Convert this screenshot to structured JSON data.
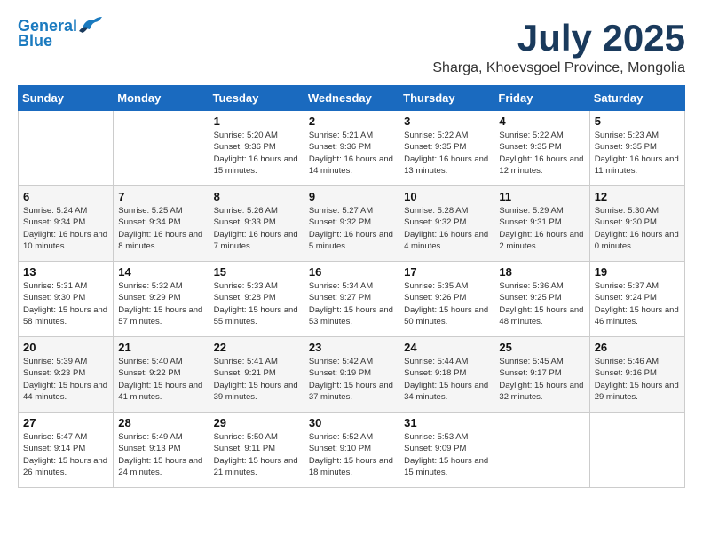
{
  "header": {
    "logo_line1": "General",
    "logo_line2": "Blue",
    "month_title": "July 2025",
    "location": "Sharga, Khoevsgoel Province, Mongolia"
  },
  "days_of_week": [
    "Sunday",
    "Monday",
    "Tuesday",
    "Wednesday",
    "Thursday",
    "Friday",
    "Saturday"
  ],
  "weeks": [
    [
      {
        "day": "",
        "sunrise": "",
        "sunset": "",
        "daylight": ""
      },
      {
        "day": "",
        "sunrise": "",
        "sunset": "",
        "daylight": ""
      },
      {
        "day": "1",
        "sunrise": "Sunrise: 5:20 AM",
        "sunset": "Sunset: 9:36 PM",
        "daylight": "Daylight: 16 hours and 15 minutes."
      },
      {
        "day": "2",
        "sunrise": "Sunrise: 5:21 AM",
        "sunset": "Sunset: 9:36 PM",
        "daylight": "Daylight: 16 hours and 14 minutes."
      },
      {
        "day": "3",
        "sunrise": "Sunrise: 5:22 AM",
        "sunset": "Sunset: 9:35 PM",
        "daylight": "Daylight: 16 hours and 13 minutes."
      },
      {
        "day": "4",
        "sunrise": "Sunrise: 5:22 AM",
        "sunset": "Sunset: 9:35 PM",
        "daylight": "Daylight: 16 hours and 12 minutes."
      },
      {
        "day": "5",
        "sunrise": "Sunrise: 5:23 AM",
        "sunset": "Sunset: 9:35 PM",
        "daylight": "Daylight: 16 hours and 11 minutes."
      }
    ],
    [
      {
        "day": "6",
        "sunrise": "Sunrise: 5:24 AM",
        "sunset": "Sunset: 9:34 PM",
        "daylight": "Daylight: 16 hours and 10 minutes."
      },
      {
        "day": "7",
        "sunrise": "Sunrise: 5:25 AM",
        "sunset": "Sunset: 9:34 PM",
        "daylight": "Daylight: 16 hours and 8 minutes."
      },
      {
        "day": "8",
        "sunrise": "Sunrise: 5:26 AM",
        "sunset": "Sunset: 9:33 PM",
        "daylight": "Daylight: 16 hours and 7 minutes."
      },
      {
        "day": "9",
        "sunrise": "Sunrise: 5:27 AM",
        "sunset": "Sunset: 9:32 PM",
        "daylight": "Daylight: 16 hours and 5 minutes."
      },
      {
        "day": "10",
        "sunrise": "Sunrise: 5:28 AM",
        "sunset": "Sunset: 9:32 PM",
        "daylight": "Daylight: 16 hours and 4 minutes."
      },
      {
        "day": "11",
        "sunrise": "Sunrise: 5:29 AM",
        "sunset": "Sunset: 9:31 PM",
        "daylight": "Daylight: 16 hours and 2 minutes."
      },
      {
        "day": "12",
        "sunrise": "Sunrise: 5:30 AM",
        "sunset": "Sunset: 9:30 PM",
        "daylight": "Daylight: 16 hours and 0 minutes."
      }
    ],
    [
      {
        "day": "13",
        "sunrise": "Sunrise: 5:31 AM",
        "sunset": "Sunset: 9:30 PM",
        "daylight": "Daylight: 15 hours and 58 minutes."
      },
      {
        "day": "14",
        "sunrise": "Sunrise: 5:32 AM",
        "sunset": "Sunset: 9:29 PM",
        "daylight": "Daylight: 15 hours and 57 minutes."
      },
      {
        "day": "15",
        "sunrise": "Sunrise: 5:33 AM",
        "sunset": "Sunset: 9:28 PM",
        "daylight": "Daylight: 15 hours and 55 minutes."
      },
      {
        "day": "16",
        "sunrise": "Sunrise: 5:34 AM",
        "sunset": "Sunset: 9:27 PM",
        "daylight": "Daylight: 15 hours and 53 minutes."
      },
      {
        "day": "17",
        "sunrise": "Sunrise: 5:35 AM",
        "sunset": "Sunset: 9:26 PM",
        "daylight": "Daylight: 15 hours and 50 minutes."
      },
      {
        "day": "18",
        "sunrise": "Sunrise: 5:36 AM",
        "sunset": "Sunset: 9:25 PM",
        "daylight": "Daylight: 15 hours and 48 minutes."
      },
      {
        "day": "19",
        "sunrise": "Sunrise: 5:37 AM",
        "sunset": "Sunset: 9:24 PM",
        "daylight": "Daylight: 15 hours and 46 minutes."
      }
    ],
    [
      {
        "day": "20",
        "sunrise": "Sunrise: 5:39 AM",
        "sunset": "Sunset: 9:23 PM",
        "daylight": "Daylight: 15 hours and 44 minutes."
      },
      {
        "day": "21",
        "sunrise": "Sunrise: 5:40 AM",
        "sunset": "Sunset: 9:22 PM",
        "daylight": "Daylight: 15 hours and 41 minutes."
      },
      {
        "day": "22",
        "sunrise": "Sunrise: 5:41 AM",
        "sunset": "Sunset: 9:21 PM",
        "daylight": "Daylight: 15 hours and 39 minutes."
      },
      {
        "day": "23",
        "sunrise": "Sunrise: 5:42 AM",
        "sunset": "Sunset: 9:19 PM",
        "daylight": "Daylight: 15 hours and 37 minutes."
      },
      {
        "day": "24",
        "sunrise": "Sunrise: 5:44 AM",
        "sunset": "Sunset: 9:18 PM",
        "daylight": "Daylight: 15 hours and 34 minutes."
      },
      {
        "day": "25",
        "sunrise": "Sunrise: 5:45 AM",
        "sunset": "Sunset: 9:17 PM",
        "daylight": "Daylight: 15 hours and 32 minutes."
      },
      {
        "day": "26",
        "sunrise": "Sunrise: 5:46 AM",
        "sunset": "Sunset: 9:16 PM",
        "daylight": "Daylight: 15 hours and 29 minutes."
      }
    ],
    [
      {
        "day": "27",
        "sunrise": "Sunrise: 5:47 AM",
        "sunset": "Sunset: 9:14 PM",
        "daylight": "Daylight: 15 hours and 26 minutes."
      },
      {
        "day": "28",
        "sunrise": "Sunrise: 5:49 AM",
        "sunset": "Sunset: 9:13 PM",
        "daylight": "Daylight: 15 hours and 24 minutes."
      },
      {
        "day": "29",
        "sunrise": "Sunrise: 5:50 AM",
        "sunset": "Sunset: 9:11 PM",
        "daylight": "Daylight: 15 hours and 21 minutes."
      },
      {
        "day": "30",
        "sunrise": "Sunrise: 5:52 AM",
        "sunset": "Sunset: 9:10 PM",
        "daylight": "Daylight: 15 hours and 18 minutes."
      },
      {
        "day": "31",
        "sunrise": "Sunrise: 5:53 AM",
        "sunset": "Sunset: 9:09 PM",
        "daylight": "Daylight: 15 hours and 15 minutes."
      },
      {
        "day": "",
        "sunrise": "",
        "sunset": "",
        "daylight": ""
      },
      {
        "day": "",
        "sunrise": "",
        "sunset": "",
        "daylight": ""
      }
    ]
  ]
}
